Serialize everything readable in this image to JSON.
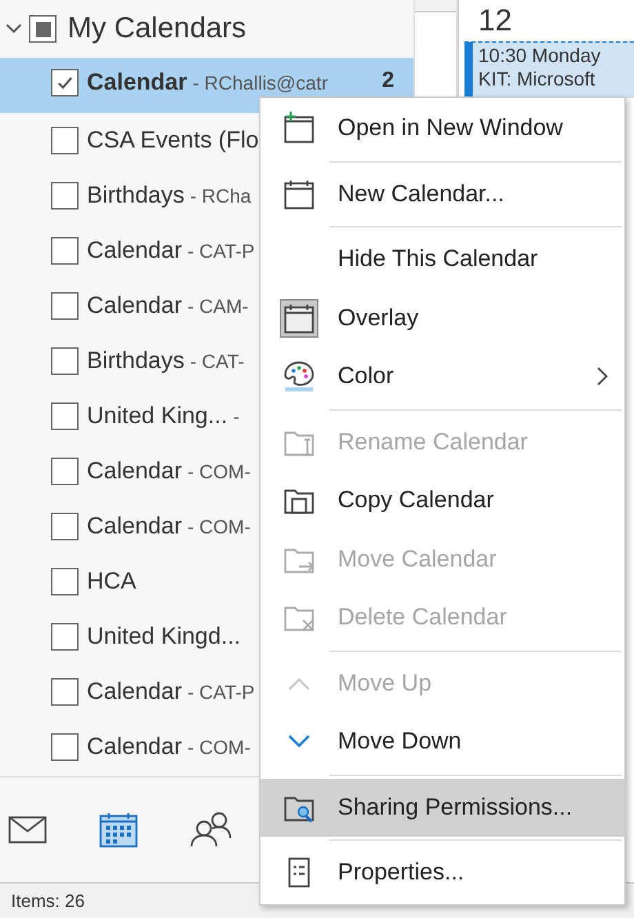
{
  "sidebar": {
    "group": {
      "label": "My Calendars",
      "expanded": true,
      "partial": true
    },
    "calendars": [
      {
        "name": "Calendar",
        "account": "- RChallis@catr",
        "count": "2",
        "checked": true,
        "selected": true
      },
      {
        "name": "CSA Events (Flo",
        "checked": false,
        "selected": false
      },
      {
        "name": "Birthdays",
        "account": "- RCha",
        "checked": false,
        "selected": false
      },
      {
        "name": "Calendar",
        "account": "- CAT-P",
        "checked": false,
        "selected": false
      },
      {
        "name": "Calendar",
        "account": "- CAM-",
        "checked": false,
        "selected": false
      },
      {
        "name": "Birthdays",
        "account": "- CAT-",
        "checked": false,
        "selected": false
      },
      {
        "name": "United King...",
        "account": "-",
        "checked": false,
        "selected": false
      },
      {
        "name": "Calendar",
        "account": "- COM-",
        "checked": false,
        "selected": false
      },
      {
        "name": "Calendar",
        "account": "- COM-",
        "checked": false,
        "selected": false
      },
      {
        "name": "HCA",
        "checked": false,
        "selected": false
      },
      {
        "name": "United Kingd...",
        "checked": false,
        "selected": false
      },
      {
        "name": "Calendar",
        "account": "- CAT-P",
        "checked": false,
        "selected": false
      },
      {
        "name": "Calendar",
        "account": "- COM-",
        "checked": false,
        "selected": false
      }
    ]
  },
  "day_view": {
    "day": "12",
    "event": {
      "lines": [
        "10:30 Monday",
        "KIT: Microsoft"
      ]
    }
  },
  "nav": [
    {
      "kind": "mail",
      "selected": false
    },
    {
      "kind": "calendar",
      "selected": true
    },
    {
      "kind": "people",
      "selected": false
    }
  ],
  "context_menu": {
    "items": [
      {
        "kind": "item",
        "label": "Open in New Window",
        "disabled": false,
        "selected": false
      },
      {
        "kind": "separator"
      },
      {
        "kind": "item",
        "label": "New Calendar...",
        "disabled": false,
        "selected": false
      },
      {
        "kind": "separator"
      },
      {
        "kind": "item",
        "label": "Hide This Calendar",
        "disabled": false,
        "selected": false
      },
      {
        "kind": "item",
        "label": "Overlay",
        "disabled": false,
        "selected": false,
        "checked": true
      },
      {
        "kind": "item",
        "label": "Color",
        "disabled": false,
        "selected": false,
        "submenu": true
      },
      {
        "kind": "separator"
      },
      {
        "kind": "item",
        "label": "Rename Calendar",
        "disabled": true,
        "selected": false
      },
      {
        "kind": "item",
        "label": "Copy Calendar",
        "disabled": false,
        "selected": false
      },
      {
        "kind": "item",
        "label": "Move Calendar",
        "disabled": true,
        "selected": false
      },
      {
        "kind": "item",
        "label": "Delete Calendar",
        "disabled": true,
        "selected": false
      },
      {
        "kind": "separator"
      },
      {
        "kind": "item",
        "label": "Move Up",
        "disabled": true,
        "selected": false
      },
      {
        "kind": "item",
        "label": "Move Down",
        "disabled": false,
        "selected": false
      },
      {
        "kind": "separator"
      },
      {
        "kind": "item",
        "label": "Sharing Permissions...",
        "disabled": false,
        "selected": true
      },
      {
        "kind": "separator"
      },
      {
        "kind": "item",
        "label": "Properties...",
        "disabled": false,
        "selected": false
      }
    ]
  },
  "status_bar": {
    "text": "Items: 26"
  }
}
